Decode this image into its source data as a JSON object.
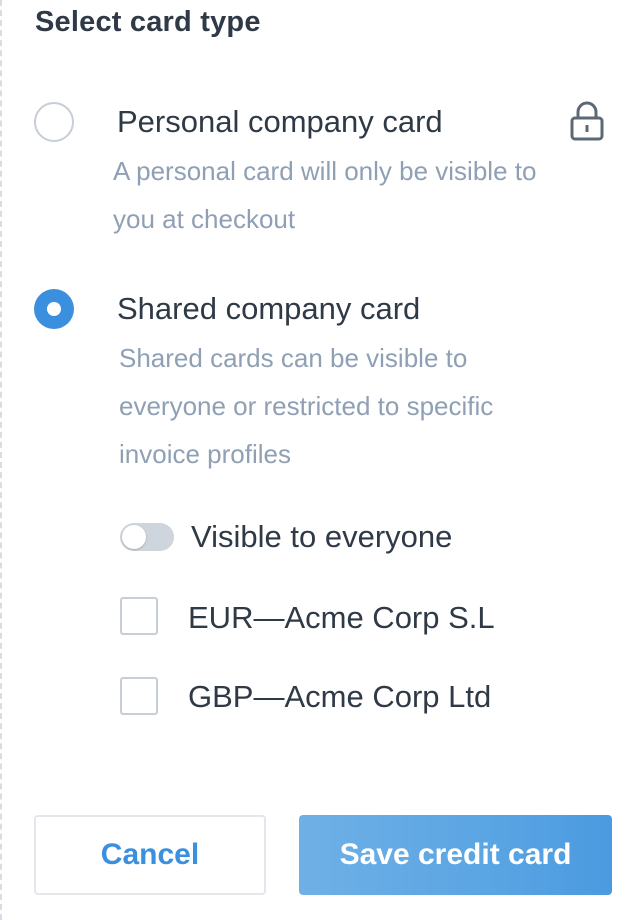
{
  "form": {
    "title": "Select card type"
  },
  "options": [
    {
      "label": "Personal company card",
      "description_line1": "A personal card will only be visible to",
      "description_line2": "you at checkout",
      "selected": false,
      "icon": "lock-icon"
    },
    {
      "label": "Shared company card",
      "description_line1": "Shared cards can be visible to",
      "description_line2": "everyone or restricted to specific",
      "description_line3": "invoice profiles",
      "selected": true
    }
  ],
  "visibility": {
    "toggle_label": "Visible to everyone",
    "toggle_on": false
  },
  "profiles": [
    {
      "label": "EUR—Acme Corp S.L",
      "checked": false
    },
    {
      "label": "GBP—Acme Corp Ltd",
      "checked": false
    }
  ],
  "actions": {
    "cancel_label": "Cancel",
    "save_label": "Save credit card"
  },
  "colors": {
    "accent": "#3a8fde",
    "text": "#2f3a46",
    "muted": "#8fa0b5"
  }
}
